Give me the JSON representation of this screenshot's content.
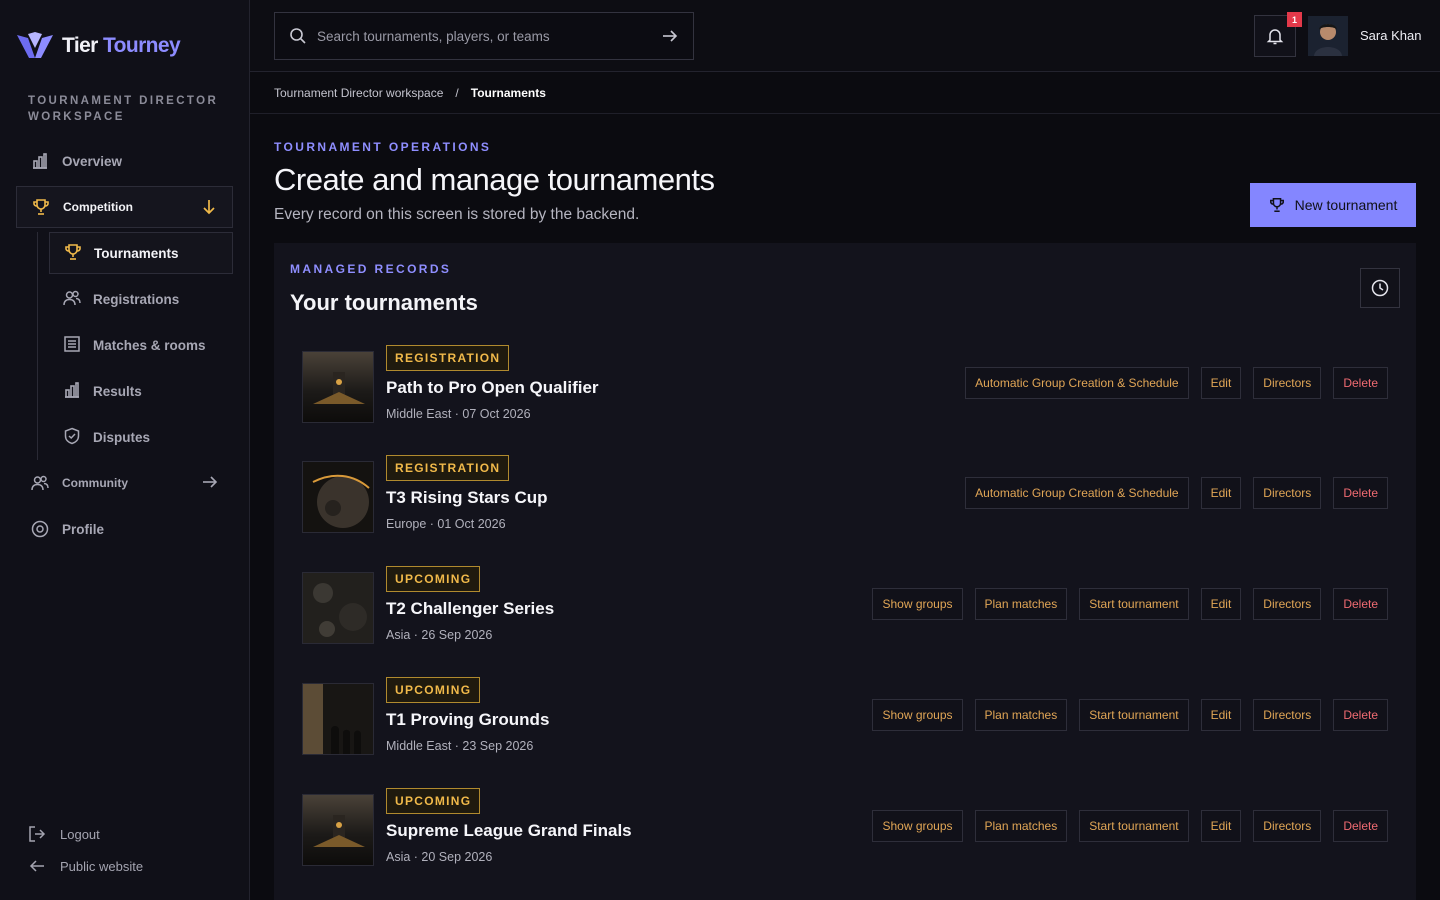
{
  "brand": {
    "name_part1": "Tier",
    "name_part2": "Tourney"
  },
  "sidebar": {
    "workspace_label": "TOURNAMENT DIRECTOR WORKSPACE",
    "overview": "Overview",
    "competition": "Competition",
    "sub_items": [
      "Tournaments",
      "Registrations",
      "Matches & rooms",
      "Results",
      "Disputes"
    ],
    "community": "Community",
    "profile": "Profile",
    "logout": "Logout",
    "public_website": "Public website"
  },
  "topbar": {
    "search_placeholder": "Search tournaments, players, or teams",
    "notification_count": "1",
    "user_name": "Sara Khan"
  },
  "breadcrumb": {
    "parent": "Tournament Director workspace",
    "separator": "/",
    "current": "Tournaments"
  },
  "header": {
    "eyebrow": "TOURNAMENT OPERATIONS",
    "title": "Create and manage tournaments",
    "subtitle": "Every record on this screen is stored by the backend.",
    "new_button": "New tournament"
  },
  "panel": {
    "eyebrow": "MANAGED RECORDS",
    "title": "Your tournaments"
  },
  "tournaments": [
    {
      "status": "REGISTRATION",
      "name": "Path to Pro Open Qualifier",
      "meta": "Middle East · 07 Oct 2026",
      "actions": [
        "Automatic Group Creation & Schedule",
        "Edit",
        "Directors",
        "Delete"
      ]
    },
    {
      "status": "REGISTRATION",
      "name": "T3 Rising Stars Cup",
      "meta": "Europe · 01 Oct 2026",
      "actions": [
        "Automatic Group Creation & Schedule",
        "Edit",
        "Directors",
        "Delete"
      ]
    },
    {
      "status": "UPCOMING",
      "name": "T2 Challenger Series",
      "meta": "Asia · 26 Sep 2026",
      "actions": [
        "Show groups",
        "Plan matches",
        "Start tournament",
        "Edit",
        "Directors",
        "Delete"
      ]
    },
    {
      "status": "UPCOMING",
      "name": "T1 Proving Grounds",
      "meta": "Middle East · 23 Sep 2026",
      "actions": [
        "Show groups",
        "Plan matches",
        "Start tournament",
        "Edit",
        "Directors",
        "Delete"
      ]
    },
    {
      "status": "UPCOMING",
      "name": "Supreme League Grand Finals",
      "meta": "Asia · 20 Sep 2026",
      "actions": [
        "Show groups",
        "Plan matches",
        "Start tournament",
        "Edit",
        "Directors",
        "Delete"
      ]
    }
  ],
  "colors": {
    "accent": "#8486ff",
    "warning": "#f0b94a",
    "action": "#e1a656",
    "danger": "#f06b72",
    "background": "#0b0b10"
  },
  "icons": [
    "logo-icon",
    "bar-chart-icon",
    "trophy-icon",
    "arrow-down-icon",
    "users-icon",
    "list-icon",
    "shield-icon",
    "arrow-right-icon",
    "settings-icon",
    "logout-icon",
    "arrow-left-icon",
    "search-icon",
    "bell-icon",
    "history-icon"
  ]
}
